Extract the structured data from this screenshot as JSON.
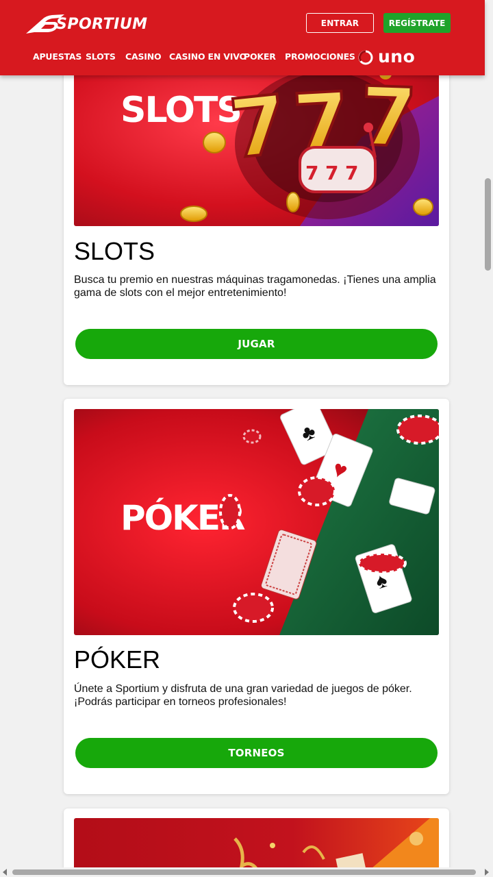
{
  "header": {
    "brand": "SPORTIUM",
    "login_label": "ENTRAR",
    "register_label": "REGÍSTRATE",
    "nav": [
      "APUESTAS",
      "SLOTS",
      "CASINO",
      "CASINO EN VIVO",
      "POKER",
      "PROMOCIONES"
    ],
    "partner_logo": "uno",
    "brand_color": "#d7191f",
    "cta_color": "#1fa32a"
  },
  "cards": [
    {
      "image_label": "SLOTS",
      "image_icon": "slot-machine-777-image",
      "title": "SLOTS",
      "description": "Busca tu premio en nuestras máquinas tragamonedas. ¡Tienes una amplia gama de slots con el mejor entretenimiento!",
      "button_label": "JUGAR"
    },
    {
      "image_label": "PÓKER",
      "image_icon": "poker-cards-chips-image",
      "title": "PÓKER",
      "description": "Únete a Sportium y disfruta de una gran variedad de juegos de póker. ¡Podrás participar en torneos profesionales!",
      "button_label": "TORNEOS"
    }
  ],
  "button_color": "#17a80b"
}
